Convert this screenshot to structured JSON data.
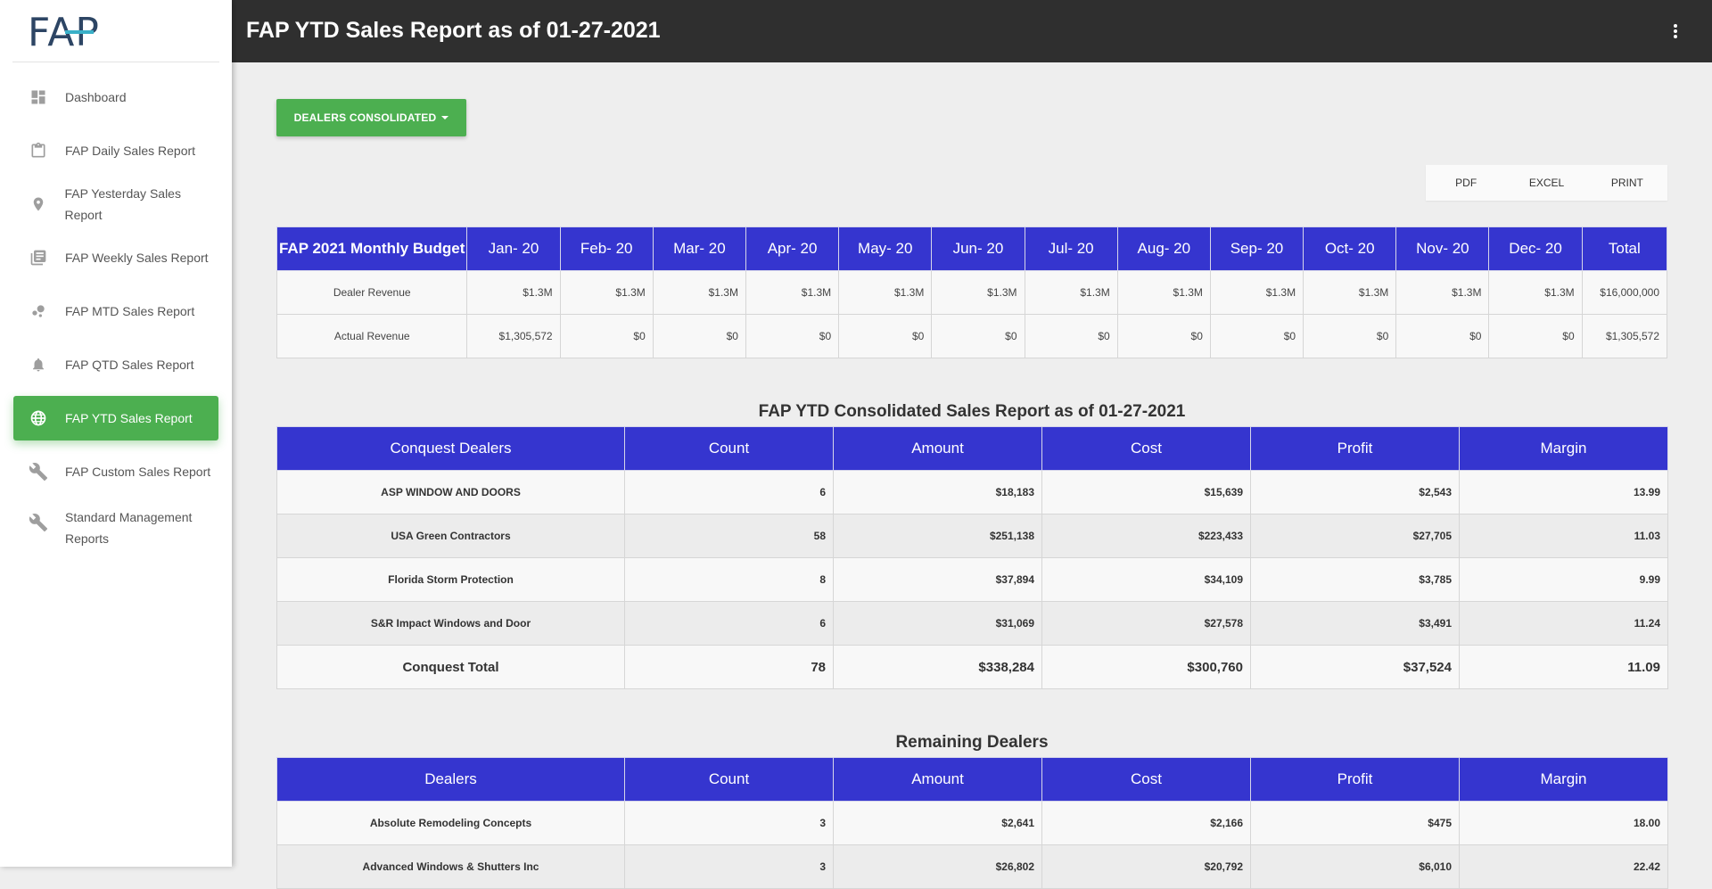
{
  "logo": {
    "text": "FAP"
  },
  "sidebar": {
    "items": [
      {
        "label": "Dashboard",
        "icon": "dashboard-icon",
        "active": false
      },
      {
        "label": "FAP Daily Sales Report",
        "icon": "clipboard-icon",
        "active": false
      },
      {
        "label": "FAP Yesterday Sales Report",
        "icon": "location-pin-icon",
        "active": false
      },
      {
        "label": "FAP Weekly Sales Report",
        "icon": "library-books-icon",
        "active": false
      },
      {
        "label": "FAP MTD Sales Report",
        "icon": "bubble-chart-icon",
        "active": false
      },
      {
        "label": "FAP QTD Sales Report",
        "icon": "bell-icon",
        "active": false
      },
      {
        "label": "FAP YTD Sales Report",
        "icon": "globe-icon",
        "active": true
      },
      {
        "label": "FAP Custom Sales Report",
        "icon": "wrench-icon",
        "active": false
      },
      {
        "label": "Standard Management Reports",
        "icon": "wrench-icon",
        "active": false
      }
    ]
  },
  "header": {
    "title": "FAP YTD Sales Report as of 01-27-2021"
  },
  "toolbar": {
    "dealers_label": "DEALERS CONSOLIDATED"
  },
  "export": {
    "pdf": "PDF",
    "excel": "EXCEL",
    "print": "PRINT"
  },
  "budget": {
    "headers": [
      "FAP 2021 Monthly Budget",
      "Jan- 20",
      "Feb- 20",
      "Mar- 20",
      "Apr- 20",
      "May- 20",
      "Jun- 20",
      "Jul- 20",
      "Aug- 20",
      "Sep- 20",
      "Oct- 20",
      "Nov- 20",
      "Dec- 20",
      "Total"
    ],
    "rows": [
      [
        "Dealer Revenue",
        "$1.3M",
        "$1.3M",
        "$1.3M",
        "$1.3M",
        "$1.3M",
        "$1.3M",
        "$1.3M",
        "$1.3M",
        "$1.3M",
        "$1.3M",
        "$1.3M",
        "$1.3M",
        "$16,000,000"
      ],
      [
        "Actual Revenue",
        "$1,305,572",
        "$0",
        "$0",
        "$0",
        "$0",
        "$0",
        "$0",
        "$0",
        "$0",
        "$0",
        "$0",
        "$0",
        "$1,305,572"
      ]
    ]
  },
  "consolidated": {
    "title": "FAP YTD Consolidated Sales Report as of 01-27-2021",
    "headers": [
      "Conquest Dealers",
      "Count",
      "Amount",
      "Cost",
      "Profit",
      "Margin"
    ],
    "rows": [
      [
        "ASP WINDOW AND DOORS",
        "6",
        "$18,183",
        "$15,639",
        "$2,543",
        "13.99"
      ],
      [
        "USA Green Contractors",
        "58",
        "$251,138",
        "$223,433",
        "$27,705",
        "11.03"
      ],
      [
        "Florida Storm Protection",
        "8",
        "$37,894",
        "$34,109",
        "$3,785",
        "9.99"
      ],
      [
        "S&R Impact Windows and Door",
        "6",
        "$31,069",
        "$27,578",
        "$3,491",
        "11.24"
      ]
    ],
    "total": [
      "Conquest Total",
      "78",
      "$338,284",
      "$300,760",
      "$37,524",
      "11.09"
    ]
  },
  "remaining": {
    "title": "Remaining Dealers",
    "headers": [
      "Dealers",
      "Count",
      "Amount",
      "Cost",
      "Profit",
      "Margin"
    ],
    "rows": [
      [
        "Absolute Remodeling Concepts",
        "3",
        "$2,641",
        "$2,166",
        "$475",
        "18.00"
      ],
      [
        "Advanced Windows & Shutters Inc",
        "3",
        "$26,802",
        "$20,792",
        "$6,010",
        "22.42"
      ]
    ]
  }
}
